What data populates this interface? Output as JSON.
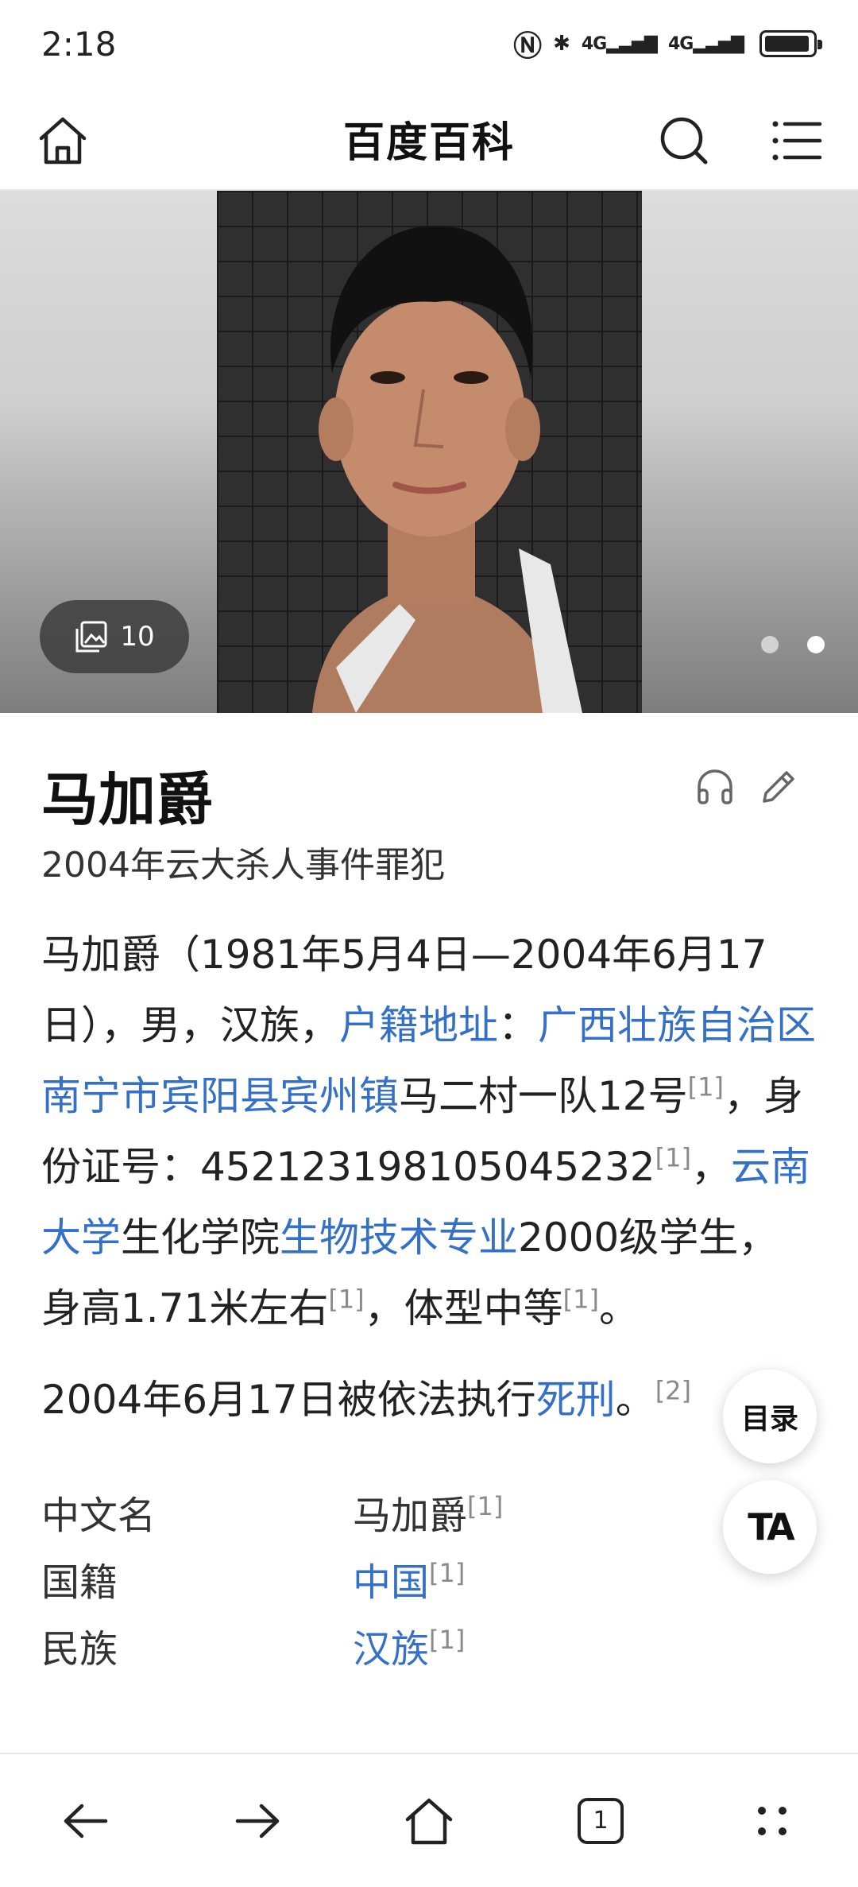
{
  "status": {
    "time": "2:18",
    "network1": "4G",
    "network2": "4G",
    "battery_level": 0.95
  },
  "nav": {
    "title": "百度百科"
  },
  "hero": {
    "photo_count": "10",
    "slide_count": 2,
    "active_slide": 2
  },
  "article": {
    "title": "马加爵",
    "subtitle": "2004年云大杀人事件罪犯",
    "summary": {
      "t1": "马加爵（1981年5月4日—2004年6月17日），男，汉族，",
      "l1": "户籍地址",
      "t2": "：",
      "l2": "广西壮族自治区南宁市宾阳县宾州镇",
      "t3": "马二村一队12号",
      "r1": "[1]",
      "t4": "，身份证号：452123198105045232",
      "r2": "[1]",
      "t5": "，",
      "l3": "云南大学",
      "t6": "生化学院",
      "l4": "生物技术专业",
      "t7": "2000级学生，身高1.71米左右",
      "r3": "[1]",
      "t8": "，体型中等",
      "r4": "[1]",
      "t9": "。"
    },
    "para2": {
      "t1": "2004年6月17日被依法执行",
      "l1": "死刑",
      "t2": "。",
      "r1": "[2]"
    },
    "info": [
      {
        "key": "中文名",
        "value": "马加爵",
        "ref": "[1]",
        "link": false
      },
      {
        "key": "国籍",
        "value": "中国",
        "ref": "[1]",
        "link": true
      },
      {
        "key": "民族",
        "value": "汉族",
        "ref": "[1]",
        "link": true
      }
    ]
  },
  "floating": {
    "toc_label": "目录",
    "ta_label": "TA"
  },
  "bottom": {
    "tab_count": "1"
  }
}
